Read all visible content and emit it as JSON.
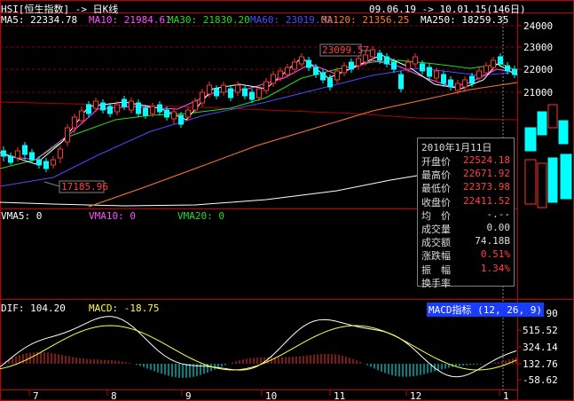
{
  "header": {
    "title": "HSI[恒生指数] -> 日K线",
    "range": "09.06.19 -> 10.01.15(146日)"
  },
  "ma_legend": [
    {
      "label": "MA5: 22334.78",
      "color": "#ffffff"
    },
    {
      "label": "MA10: 21984.61",
      "color": "#ff4fff"
    },
    {
      "label": "MA30: 21830.20",
      "color": "#22dd22"
    },
    {
      "label": "MA60: 23019.02",
      "color": "#4b4bff"
    },
    {
      "label": "MA120: 21356.25",
      "color": "#ff7a30"
    },
    {
      "label": "MA250: 18259.35",
      "color": "#ffffff"
    }
  ],
  "price_axis": [
    "24000",
    "23000",
    "22000",
    "21000"
  ],
  "annotations": {
    "high": "23099.57",
    "low": "17185.96"
  },
  "vma_legend": [
    {
      "label": "VMA5: 0",
      "color": "#ffffff"
    },
    {
      "label": "VMA10: 0",
      "color": "#ff4fff"
    },
    {
      "label": "VMA20: 0",
      "color": "#22dd22"
    }
  ],
  "macd_legend": {
    "dif": "DIF: 104.20",
    "macd": "MACD: -18.75",
    "indicator": "MACD指标 (12, 26, 9)"
  },
  "macd_axis": [
    "706.90",
    "515.52",
    "324.14",
    "132.76",
    "-58.62"
  ],
  "date_axis": [
    "7",
    "8",
    "9",
    "10",
    "11",
    "12",
    "1"
  ],
  "info": {
    "date": "2010年1月11日",
    "rows": [
      {
        "k": "开盘价",
        "v": "22524.18",
        "color": "#ff4040"
      },
      {
        "k": "最高价",
        "v": "22671.92",
        "color": "#ff4040"
      },
      {
        "k": "最低价",
        "v": "22373.98",
        "color": "#ff4040"
      },
      {
        "k": "收盘价",
        "v": "22411.52",
        "color": "#ff4040"
      },
      {
        "k": "均　价",
        "v": "-.--",
        "color": "#dddddd"
      },
      {
        "k": "成交量",
        "v": "0.00",
        "color": "#dddddd"
      },
      {
        "k": "成交额",
        "v": "74.18B",
        "color": "#dddddd"
      },
      {
        "k": "涨跌幅",
        "v": "0.51%",
        "color": "#ff4040"
      },
      {
        "k": "振　幅",
        "v": "1.34%",
        "color": "#ff4040"
      },
      {
        "k": "换手率",
        "v": "",
        "color": "#dddddd"
      }
    ]
  },
  "colors": {
    "up": "#ff3030",
    "down": "#00ffff",
    "grid": "#8b0000",
    "panel": "#c00000"
  }
}
